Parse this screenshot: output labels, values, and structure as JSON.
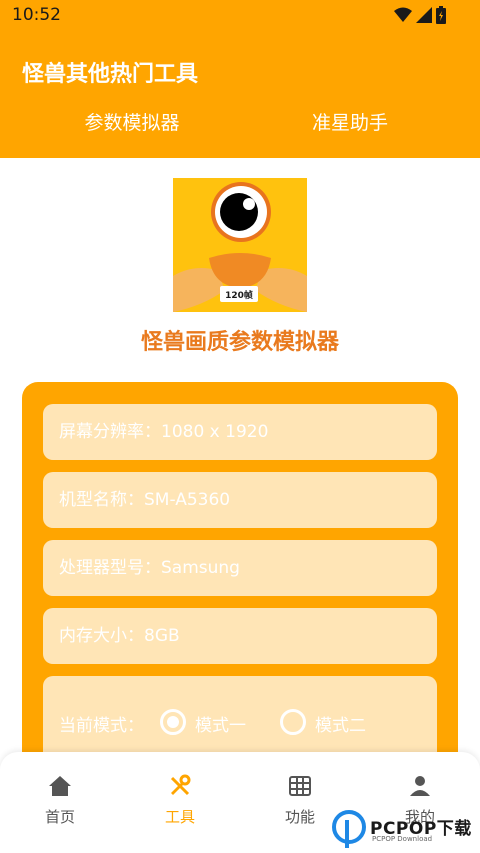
{
  "status": {
    "time": "10:52"
  },
  "header": {
    "title": "怪兽其他热门工具",
    "tabs": [
      {
        "label": "参数模拟器"
      },
      {
        "label": "准星助手"
      }
    ]
  },
  "logo": {
    "badge": "120帧"
  },
  "main": {
    "heading": "怪兽画质参数模拟器",
    "fields": [
      {
        "text": "屏幕分辨率：1080 x 1920"
      },
      {
        "text": "机型名称：SM-A5360"
      },
      {
        "text": "处理器型号：Samsung"
      },
      {
        "text": "内存大小：8GB"
      }
    ],
    "mode": {
      "label": "当前模式：",
      "options": [
        "模式一",
        "模式二"
      ],
      "selected": "模式一"
    }
  },
  "bottom_nav": [
    {
      "label": "首页",
      "icon": "home-icon"
    },
    {
      "label": "工具",
      "icon": "tools-icon",
      "active": true
    },
    {
      "label": "功能",
      "icon": "grid-icon"
    },
    {
      "label": "我的",
      "icon": "person-icon"
    }
  ],
  "watermark": {
    "brand": "PCPOP下载",
    "sub": "PCPOP Download"
  },
  "colors": {
    "accent": "#FFA500",
    "field_bg": "#FFE5B6",
    "heading": "#E97A1E"
  }
}
